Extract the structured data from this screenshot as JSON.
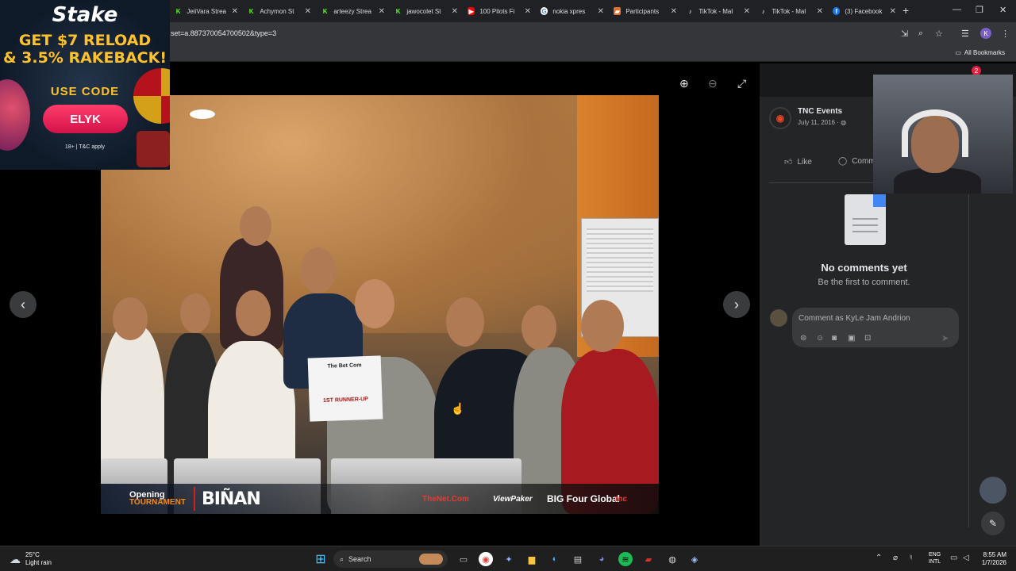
{
  "browser": {
    "tabs": [
      {
        "title": "JeiiVara Strea",
        "icon_color": "#53fc18",
        "icon_glyph": "K"
      },
      {
        "title": "Achymon St",
        "icon_color": "#53fc18",
        "icon_glyph": "K"
      },
      {
        "title": "arteezy Strea",
        "icon_color": "#53fc18",
        "icon_glyph": "K"
      },
      {
        "title": "jawocolet St",
        "icon_color": "#53fc18",
        "icon_glyph": "K"
      },
      {
        "title": "100 Pilots Fi",
        "icon_color": "#ff0000",
        "icon_glyph": "▶"
      },
      {
        "title": "nokia xpres",
        "icon_color": "#ffffff",
        "icon_glyph": "G"
      },
      {
        "title": "Participants",
        "icon_color": "#e2702a",
        "icon_glyph": "▰"
      },
      {
        "title": "TikTok - Mal",
        "icon_color": "#111111",
        "icon_glyph": "♪"
      },
      {
        "title": "TikTok - Mal",
        "icon_color": "#111111",
        "icon_glyph": "♪"
      },
      {
        "title": "(3) Facebook",
        "icon_color": "#1877f2",
        "icon_glyph": "f"
      }
    ],
    "new_tab": "+",
    "url": "set=a.887370054700502&type=3",
    "profile_initial": "K",
    "all_bookmarks": "All Bookmarks"
  },
  "ad": {
    "brand": "Stake",
    "line1": "GET $7 RELOAD",
    "line2": "& 3.5% RAKEBACK!",
    "use_code": "USE CODE",
    "code": "ELYK",
    "terms": "18+ | T&C apply"
  },
  "photo": {
    "sign_text": "The Bet Com",
    "sign_sub": "1ST RUNNER-UP",
    "banner_left_1": "Opening",
    "banner_left_2": "TOURNAMENT",
    "banner_city": "BIÑAN",
    "sponsors": [
      "TheNet.Com",
      "ViewPaker",
      "BIG Four Global",
      "tnc"
    ]
  },
  "post": {
    "page_name": "TNC Events",
    "date": "July 11, 2016 · ",
    "like_label": "Like",
    "comment_label": "Comm",
    "notifications": "2",
    "no_comments": "No comments yet",
    "be_first": "Be the first to comment.",
    "comment_placeholder": "Comment as KyLe Jam Andrion"
  },
  "taskbar": {
    "temp": "25°C",
    "weather": "Light rain",
    "search": "Search",
    "lang1": "ENG",
    "lang2": "INTL",
    "time": "8:55 AM",
    "date": "1/7/2026"
  }
}
